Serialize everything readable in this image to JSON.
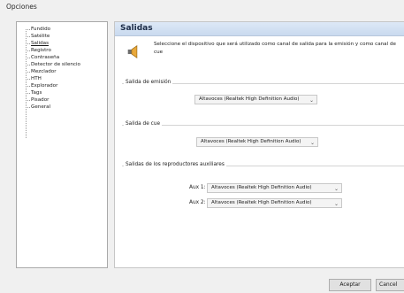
{
  "window": {
    "title": "Opciones"
  },
  "tree": {
    "items": [
      "Fundido",
      "Satélite",
      "Salidas",
      "Registro",
      "Contraseña",
      "Detector de silencio",
      "Mezclador",
      "HTH",
      "Explorador",
      "Tags",
      "Pisador",
      "General"
    ],
    "selected_index": 2
  },
  "panel": {
    "title": "Salidas",
    "description": "Seleccione el dispositivo que será utilizado como canal de salida para la emisión y como canal de cue",
    "speaker_icon": "speaker-icon"
  },
  "groups": {
    "emision": {
      "label": "Salida de emisión",
      "device": "Altavoces (Realtek High Definition Audio)"
    },
    "cue": {
      "label": "Salida de cue",
      "device": "Altavoces (Realtek High Definition Audio)"
    },
    "aux": {
      "label": "Salidas de los reproductores auxiliares",
      "aux1_label": "Aux 1:",
      "aux1_device": "Altavoces (Realtek High Definition Audio)",
      "aux2_label": "Aux 2:",
      "aux2_device": "Altavoces (Realtek High Definition Audio)"
    }
  },
  "buttons": {
    "accept": "Aceptar",
    "cancel": "Cancel"
  },
  "colors": {
    "header_bg": "#c9daef",
    "title": "#1a2a46"
  }
}
